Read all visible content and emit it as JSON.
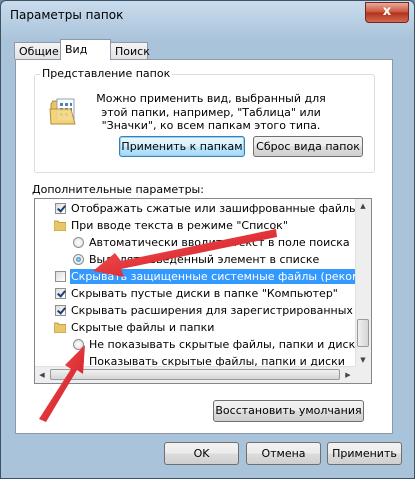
{
  "window": {
    "title": "Параметры папок",
    "close_symbol": "x"
  },
  "tabs": [
    {
      "label": "Общие"
    },
    {
      "label": "Вид",
      "active": true
    },
    {
      "label": "Поиск"
    }
  ],
  "folder_views": {
    "group_label": "Представление папок",
    "description": "Можно применить вид, выбранный для этой папки, например, \"Таблица\" или \"Значки\", ко всем папкам этого типа.",
    "apply_button": "Применить к папкам",
    "reset_button": "Сброс вида папок"
  },
  "advanced": {
    "label": "Дополнительные параметры:",
    "items": [
      {
        "type": "checkbox",
        "checked": true,
        "indent": 1,
        "label": "Отображать сжатые или зашифрованные файлы NTFS другим цветом"
      },
      {
        "type": "folder",
        "indent": 1,
        "label": "При вводе текста в режиме \"Список\""
      },
      {
        "type": "radio",
        "checked": false,
        "indent": 2,
        "label": "Автоматически вводить текст в поле поиска"
      },
      {
        "type": "radio",
        "checked": true,
        "indent": 2,
        "label": "Выделять введенный элемент в списке"
      },
      {
        "type": "checkbox",
        "checked": false,
        "indent": 1,
        "selected": true,
        "label": "Скрывать защищенные системные файлы (рекомендуется)"
      },
      {
        "type": "checkbox",
        "checked": true,
        "indent": 1,
        "label": "Скрывать пустые диски в папке \"Компьютер\""
      },
      {
        "type": "checkbox",
        "checked": true,
        "indent": 1,
        "label": "Скрывать расширения для зарегистрированных типов файлов"
      },
      {
        "type": "folder",
        "indent": 1,
        "label": "Скрытые файлы и папки"
      },
      {
        "type": "radio",
        "checked": false,
        "indent": 2,
        "label": "Не показывать скрытые файлы, папки и диски"
      },
      {
        "type": "radio",
        "checked": true,
        "indent": 2,
        "label": "Показывать скрытые файлы, папки и диски"
      }
    ],
    "restore_button": "Восстановить умолчания"
  },
  "footer": {
    "ok": "OK",
    "cancel": "Отмена",
    "apply": "Применить"
  },
  "colors": {
    "selection": "#3399ff",
    "annotation_arrow": "#e8202a"
  }
}
